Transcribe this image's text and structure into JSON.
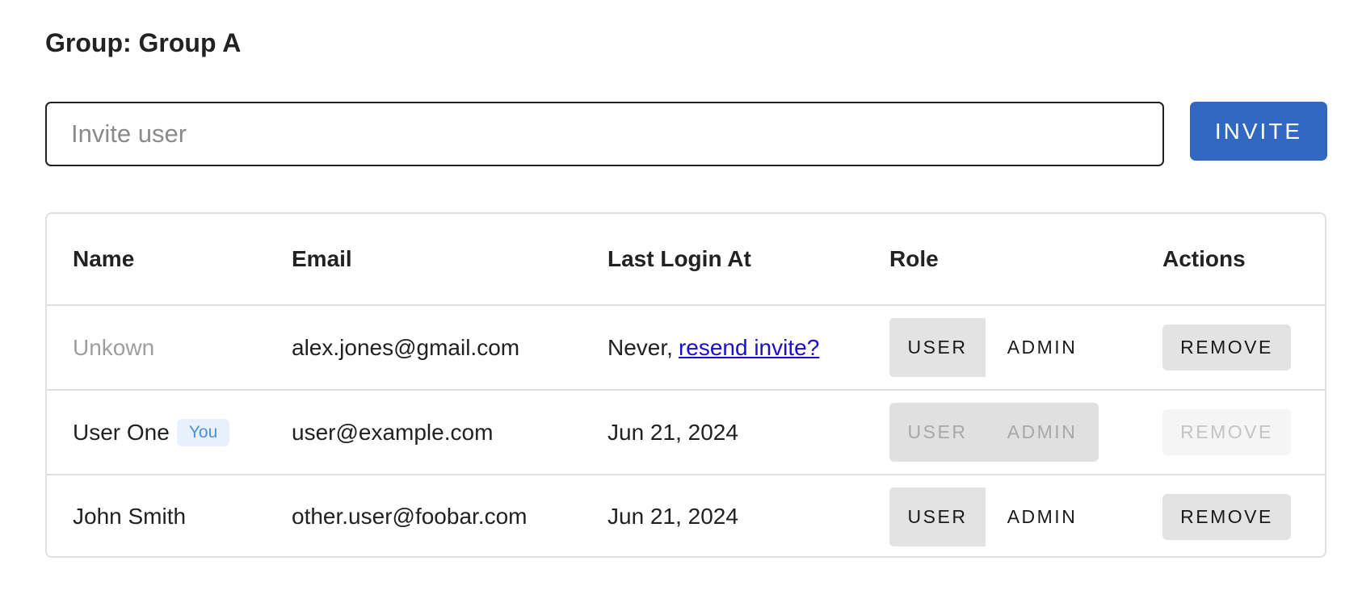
{
  "group": {
    "title": "Group: Group A"
  },
  "invite": {
    "placeholder": "Invite user",
    "value": "",
    "button_label": "INVITE"
  },
  "table": {
    "columns": [
      "Name",
      "Email",
      "Last Login At",
      "Role",
      "Actions"
    ],
    "rows": [
      {
        "name": "Unkown",
        "name_muted": true,
        "badge": "",
        "email": "alex.jones@gmail.com",
        "last_login_prefix": "Never,",
        "last_login_link": "resend invite?",
        "last_login": "",
        "role_user": "USER",
        "role_admin": "ADMIN",
        "selected_role": "USER",
        "role_disabled": false,
        "remove_label": "REMOVE",
        "remove_disabled": false
      },
      {
        "name": "User One",
        "name_muted": false,
        "badge": "You",
        "email": "user@example.com",
        "last_login_prefix": "",
        "last_login_link": "",
        "last_login": "Jun 21, 2024",
        "role_user": "USER",
        "role_admin": "ADMIN",
        "selected_role": "",
        "role_disabled": true,
        "remove_label": "REMOVE",
        "remove_disabled": true
      },
      {
        "name": "John Smith",
        "name_muted": false,
        "badge": "",
        "email": "other.user@foobar.com",
        "last_login_prefix": "",
        "last_login_link": "",
        "last_login": "Jun 21, 2024",
        "role_user": "USER",
        "role_admin": "ADMIN",
        "selected_role": "USER",
        "role_disabled": false,
        "remove_label": "REMOVE",
        "remove_disabled": false
      }
    ]
  },
  "colors": {
    "primary": "#3268c0",
    "link": "#1a0dcc",
    "badge_bg": "#e8f1fb",
    "badge_text": "#4a90d9",
    "border": "#e0e0e0"
  }
}
